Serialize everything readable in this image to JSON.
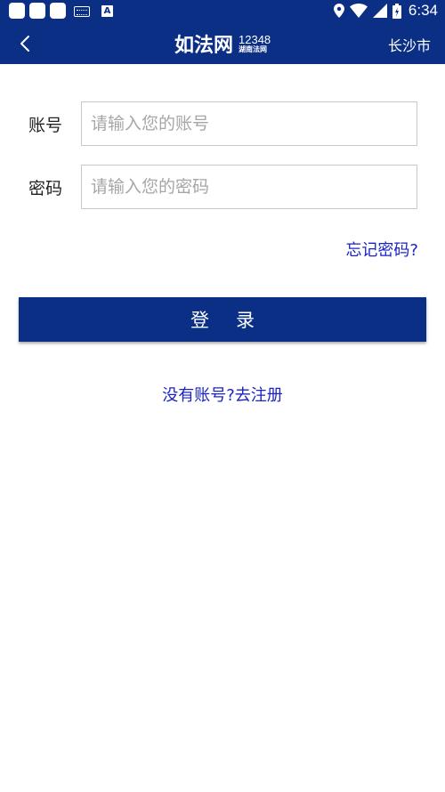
{
  "status_bar": {
    "time": "6:34",
    "icons": [
      "notification-icon",
      "notification-icon",
      "notification-icon",
      "keyboard-icon",
      "app-a-icon",
      "location-icon",
      "wifi-icon",
      "signal-icon",
      "battery-icon"
    ]
  },
  "header": {
    "logo_text": "如法网",
    "logo_number": "12348",
    "logo_subtitle": "湖南法网",
    "city": "长沙市"
  },
  "form": {
    "account_label": "账号",
    "account_placeholder": "请输入您的账号",
    "account_value": "",
    "password_label": "密码",
    "password_placeholder": "请输入您的密码",
    "password_value": "",
    "forgot_link": "忘记密码?",
    "login_button": "登录",
    "register_link": "没有账号?去注册"
  },
  "colors": {
    "primary": "#0a2f84",
    "link": "#1a23c4",
    "placeholder": "#a6a6a6",
    "border": "#c8c8c8"
  }
}
